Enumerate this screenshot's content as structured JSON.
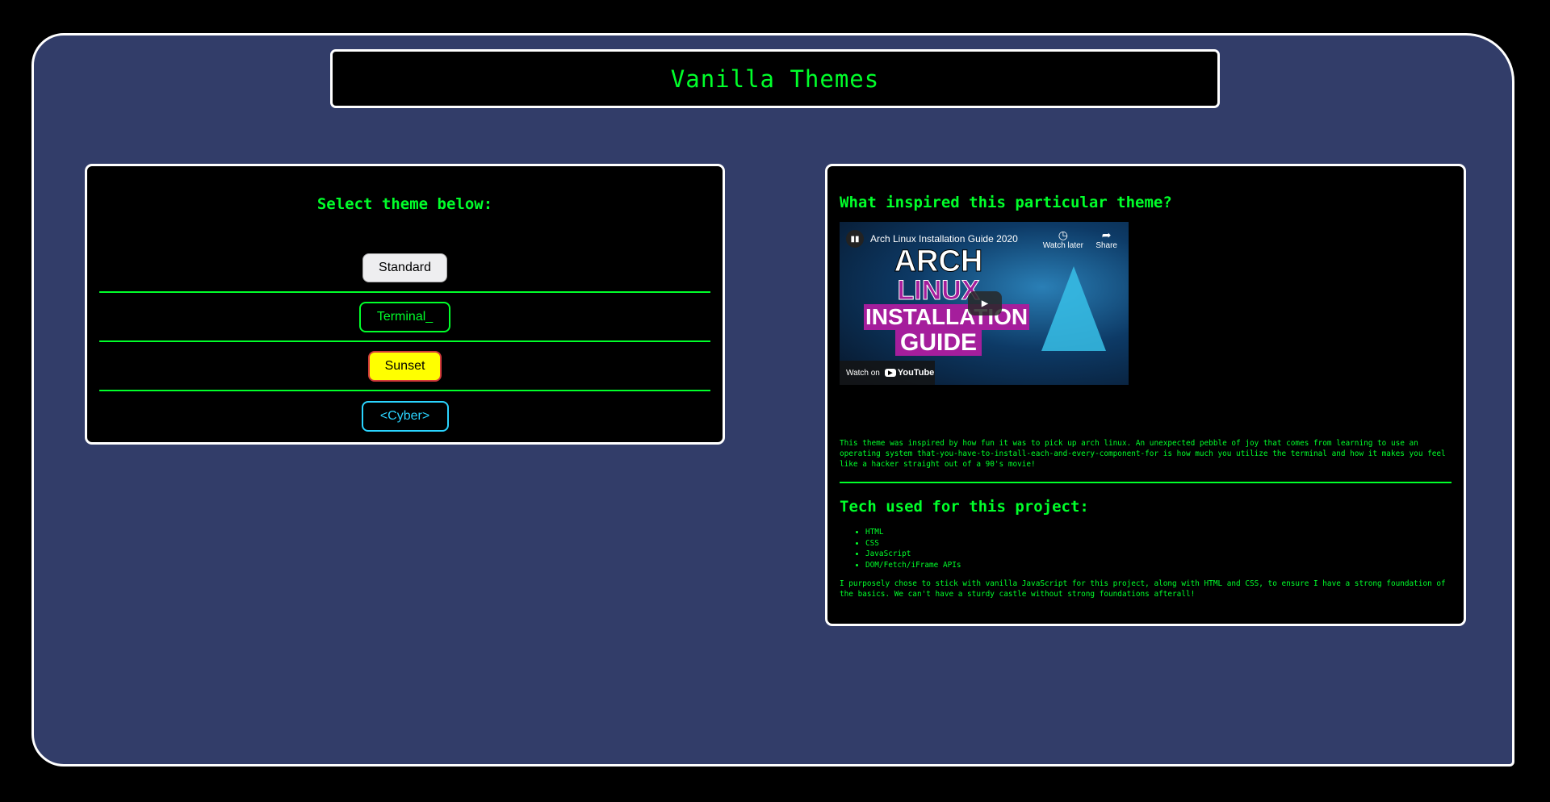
{
  "app": {
    "title": "Vanilla Themes"
  },
  "theme_selector": {
    "heading": "Select theme below:",
    "themes": [
      {
        "label": "Standard"
      },
      {
        "label": "Terminal_"
      },
      {
        "label": "Sunset"
      },
      {
        "label": "<Cyber>"
      }
    ]
  },
  "inspiration": {
    "heading": "What inspired this particular theme?",
    "video": {
      "title": "Arch Linux Installation Guide 2020",
      "watch_later": "Watch later",
      "share": "Share",
      "watch_on": "Watch on",
      "youtube": "YouTube",
      "art_line1": "ARCH",
      "art_line2": "LINUX",
      "art_line3": "INSTALLATION",
      "art_line4": "GUIDE"
    },
    "description": "This theme was inspired by how fun it was to pick up arch linux. An unexpected pebble of joy that comes from learning to use an operating system that-you-have-to-install-each-and-every-component-for is how much you utilize the terminal and how it makes you feel like a hacker straight out of a 90's movie!"
  },
  "tech": {
    "heading": "Tech used for this project:",
    "items": [
      "HTML",
      "CSS",
      "JavaScript",
      "DOM/Fetch/iFrame APIs"
    ],
    "closing": "I purposely chose to stick with vanilla JavaScript for this project, along with HTML and CSS, to ensure I have a strong foundation of the basics. We can't have a sturdy castle without strong foundations afterall!"
  },
  "colors": {
    "accent": "#00ff2a",
    "frame_bg": "#323d69",
    "panel_bg": "#000000",
    "cyber": "#2ad4ff",
    "sunset_fill": "#ffff00",
    "sunset_border": "#d23a3a"
  }
}
